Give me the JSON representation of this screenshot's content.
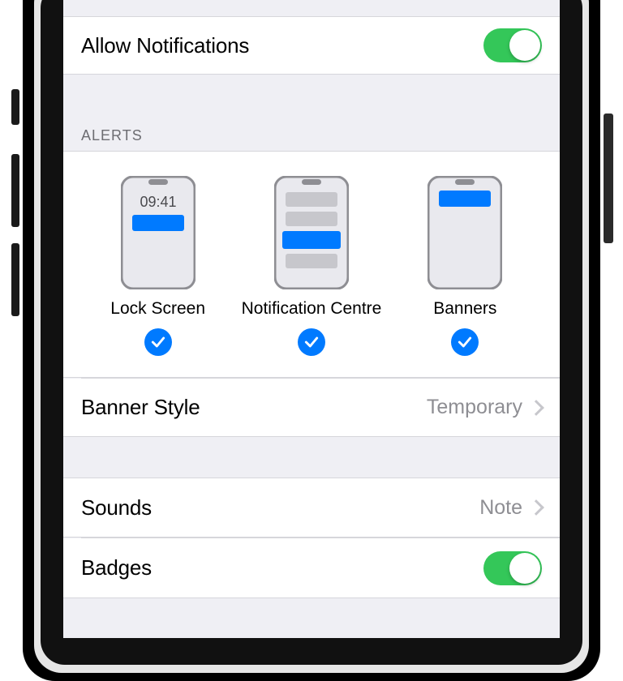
{
  "allow_notifications": {
    "label": "Allow Notifications",
    "on": true
  },
  "alerts": {
    "header": "ALERTS",
    "time_sample": "09:41",
    "options": [
      {
        "label": "Lock Screen",
        "checked": true
      },
      {
        "label": "Notification Centre",
        "checked": true
      },
      {
        "label": "Banners",
        "checked": true
      }
    ]
  },
  "banner_style": {
    "label": "Banner Style",
    "value": "Temporary"
  },
  "sounds": {
    "label": "Sounds",
    "value": "Note"
  },
  "badges": {
    "label": "Badges",
    "on": true
  },
  "colors": {
    "ios_blue": "#007aff",
    "ios_green": "#34c759",
    "chevron": "#c7c7cc",
    "secondary_text": "#8e8e93",
    "group_bg": "#efeff4"
  }
}
